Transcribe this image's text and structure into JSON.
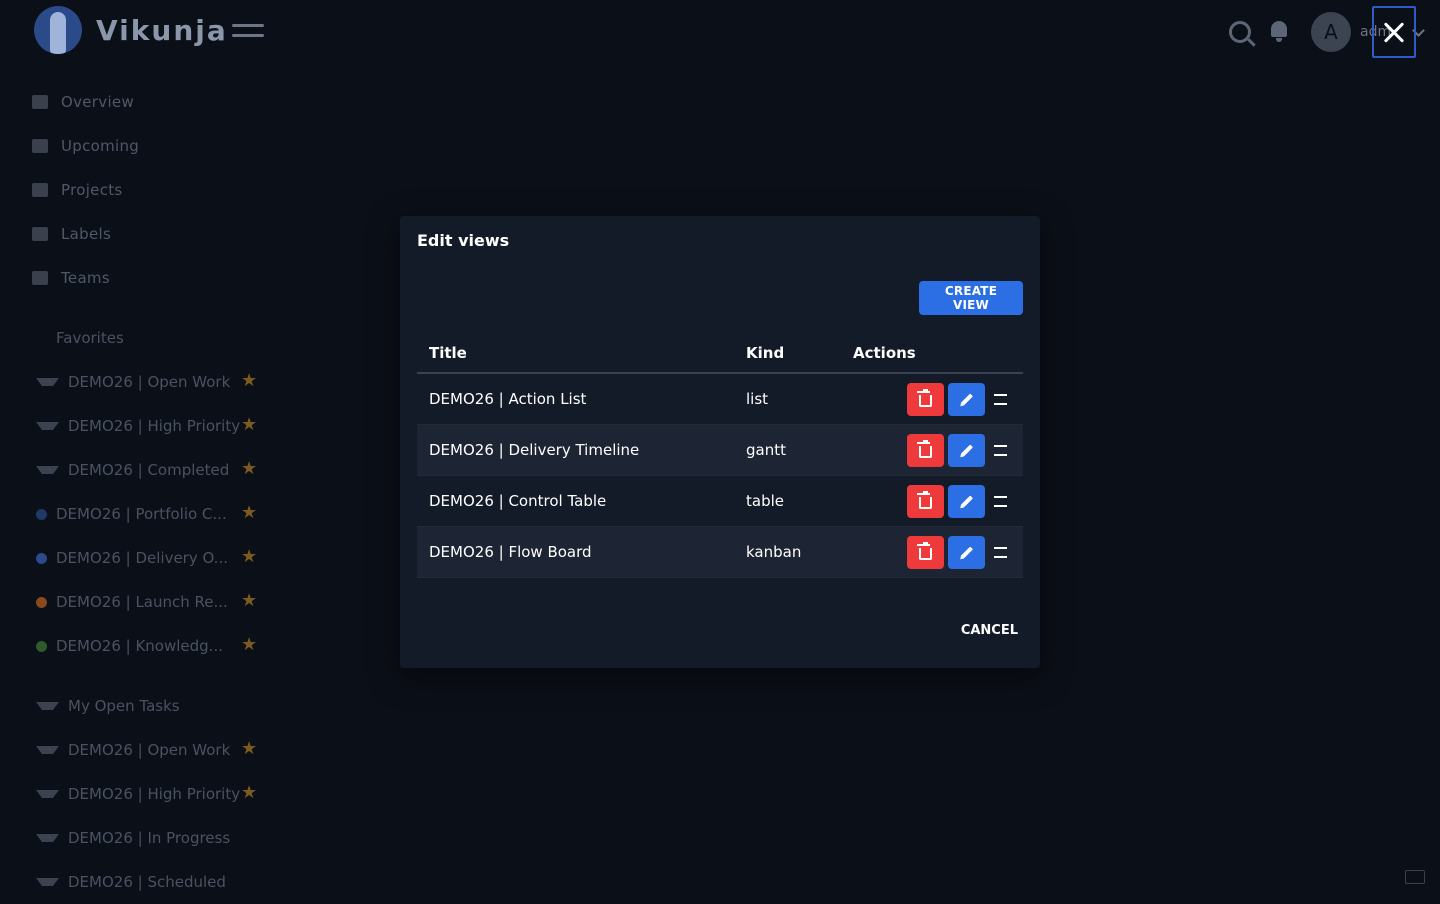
{
  "app": {
    "name": "Vikunja",
    "user_initial": "A",
    "username": "admin"
  },
  "nav": [
    {
      "label": "Overview",
      "icon": "calendar-icon"
    },
    {
      "label": "Upcoming",
      "icon": "calendar-grid-icon"
    },
    {
      "label": "Projects",
      "icon": "layers-icon"
    },
    {
      "label": "Labels",
      "icon": "tags-icon"
    },
    {
      "label": "Teams",
      "icon": "users-icon"
    }
  ],
  "favorites": {
    "heading": "Favorites",
    "items": [
      {
        "label": "DEMO26 | Open Work",
        "bullet": "filter",
        "color": "#3b4250"
      },
      {
        "label": "DEMO26 | High Priority",
        "bullet": "filter",
        "color": "#3b4250"
      },
      {
        "label": "DEMO26 | Completed",
        "bullet": "filter",
        "color": "#3b4250"
      },
      {
        "label": "DEMO26 | Portfolio C...",
        "bullet": "dot",
        "color": "#1f3a66"
      },
      {
        "label": "DEMO26 | Delivery O...",
        "bullet": "dot",
        "color": "#2b4a8a"
      },
      {
        "label": "DEMO26 | Launch Re...",
        "bullet": "dot",
        "color": "#8a4a1c"
      },
      {
        "label": "DEMO26 | Knowledg...",
        "bullet": "dot",
        "color": "#2f5a2a"
      }
    ]
  },
  "my_tasks": {
    "heading": "My Open Tasks",
    "items": [
      {
        "label": "DEMO26 | Open Work",
        "starred": true
      },
      {
        "label": "DEMO26 | High Priority",
        "starred": true
      },
      {
        "label": "DEMO26 | In Progress",
        "starred": false
      },
      {
        "label": "DEMO26 | Scheduled",
        "starred": false
      }
    ]
  },
  "modal": {
    "title": "Edit views",
    "create_label": "CREATE VIEW",
    "cancel_label": "CANCEL",
    "columns": [
      "Title",
      "Kind",
      "Actions"
    ],
    "views": [
      {
        "title": "DEMO26 | Action List",
        "kind": "list"
      },
      {
        "title": "DEMO26 | Delivery Timeline",
        "kind": "gantt"
      },
      {
        "title": "DEMO26 | Control Table",
        "kind": "table"
      },
      {
        "title": "DEMO26 | Flow Board",
        "kind": "kanban"
      }
    ]
  },
  "colors": {
    "primary": "#2c6fe5",
    "danger": "#ee3a3a",
    "modal_bg": "#141b28",
    "star": "#7a5a1e"
  }
}
